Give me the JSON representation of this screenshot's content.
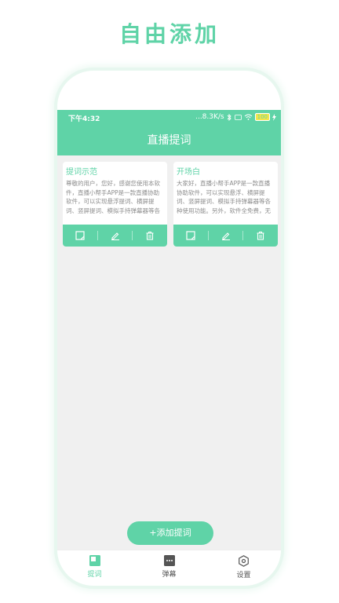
{
  "promo": {
    "title": "自由添加"
  },
  "statusbar": {
    "time": "下午4:32",
    "speed": "...8.3K/s",
    "battery": "100"
  },
  "appbar": {
    "title": "直播提词"
  },
  "cards": [
    {
      "title": "提词示范",
      "body": "尊敬的用户，您好，感谢您使用本软件，直播小帮手APP是一款直播协助软件，可以实现悬浮提词、横屏提词、竖屏提词、模拟手持弹幕器等各"
    },
    {
      "title": "开场白",
      "body": "大家好，直播小帮手APP是一款直播协助软件，可以实现悬浮、横屏提词、竖屏提词、模拟手持弹幕器等各种使用功能。另外，软件全免费，无"
    }
  ],
  "card_actions": [
    "square-icon",
    "pencil-icon",
    "trash-icon"
  ],
  "fab": {
    "label": "+添加提词"
  },
  "tabs": [
    {
      "label": "提词",
      "icon": "note-icon",
      "active": true
    },
    {
      "label": "弹幕",
      "icon": "danmaku-icon",
      "active": false
    },
    {
      "label": "设置",
      "icon": "settings-hex-icon",
      "active": false
    }
  ],
  "navbar": [
    "back-icon",
    "home-icon",
    "menu-icon",
    "accessibility-icon"
  ],
  "colors": {
    "accent": "#5fd3a7",
    "background": "#f0f0f0"
  }
}
